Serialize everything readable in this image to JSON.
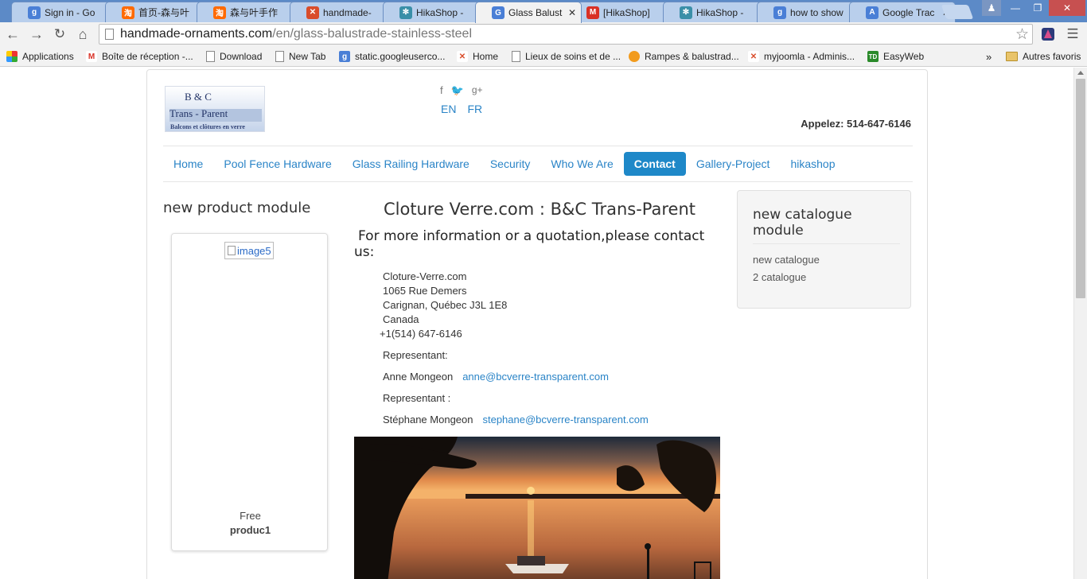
{
  "browser": {
    "tabs": [
      {
        "title": "Sign in - Go",
        "icon": "google-icon",
        "color": "#4a7fd6",
        "glyph": "g"
      },
      {
        "title": "首页-森与叶",
        "icon": "taobao-icon",
        "color": "#ff6a00",
        "glyph": "淘"
      },
      {
        "title": "森与叶手作",
        "icon": "taobao-icon",
        "color": "#ff6a00",
        "glyph": "淘"
      },
      {
        "title": "handmade-",
        "icon": "joomla-icon",
        "color": "#d94c2a",
        "glyph": "✕"
      },
      {
        "title": "HikaShop -",
        "icon": "hikashop-icon",
        "color": "#3a8fa8",
        "glyph": "✻"
      },
      {
        "title": "Glass Balust",
        "icon": "google-icon",
        "color": "#4a7fd6",
        "glyph": "G"
      },
      {
        "title": "[HikaShop]",
        "icon": "gmail-icon",
        "color": "#d93025",
        "glyph": "M"
      },
      {
        "title": "HikaShop -",
        "icon": "hikashop-icon",
        "color": "#3a8fa8",
        "glyph": "✻"
      },
      {
        "title": "how to show",
        "icon": "google-icon",
        "color": "#4a7fd6",
        "glyph": "g"
      },
      {
        "title": "Google Trac",
        "icon": "translate-icon",
        "color": "#4a7fd6",
        "glyph": "A"
      }
    ],
    "active_tab": 5,
    "url_host": "handmade-ornaments.com",
    "url_path": "/en/glass-balustrade-stainless-steel",
    "bookmarks": [
      {
        "label": "Applications",
        "icon": "apps-grid-icon"
      },
      {
        "label": "Boîte de réception -...",
        "icon": "gmail-icon"
      },
      {
        "label": "Download",
        "icon": "page-icon"
      },
      {
        "label": "New Tab",
        "icon": "page-icon"
      },
      {
        "label": "static.googleuserco...",
        "icon": "google-icon"
      },
      {
        "label": "Home",
        "icon": "joomla-icon"
      },
      {
        "label": "Lieux de soins et de ...",
        "icon": "page-icon"
      },
      {
        "label": "Rampes & balustrad...",
        "icon": "site-icon"
      },
      {
        "label": "myjoomla - Adminis...",
        "icon": "joomla-icon"
      },
      {
        "label": "EasyWeb",
        "icon": "td-bank-icon"
      }
    ],
    "bookmarks_overflow": "»",
    "other_bookmarks": "Autres favoris"
  },
  "site": {
    "logo": {
      "row1": "B    &    C",
      "row2": "Trans   -   Parent",
      "tagline": "Balcons et clôtures en verre"
    },
    "languages": [
      "EN",
      "FR"
    ],
    "phone": "Appelez: 514-647-6146",
    "menu": [
      "Home",
      "Pool Fence Hardware",
      "Glass Railing Hardware",
      "Security",
      "Who We Are",
      "Contact",
      "Gallery-Project",
      "hikashop"
    ],
    "active_menu": 5,
    "left_module": {
      "title": "new product module",
      "product": {
        "image_alt": "image5",
        "price": "Free",
        "name": "produc1"
      }
    },
    "main": {
      "title": "Cloture Verre.com : B&C Trans-Parent",
      "subtitle": "For more information or a quotation,please  contact us:",
      "address": [
        "Cloture-Verre.com",
        "1065 Rue Demers",
        "Carignan, Québec J3L 1E8",
        "Canada",
        "+1(514) 647-6146"
      ],
      "rep_label_1": "Representant:",
      "rep_name_1": "Anne Mongeon",
      "rep_email_1": "anne@bcverre-transparent.com",
      "rep_label_2": "Representant :",
      "rep_name_2": "Stéphane Mongeon",
      "rep_email_2": "stephane@bcverre-transparent.com"
    },
    "right_module": {
      "title": "new catalogue module",
      "items": [
        "new catalogue",
        "2 catalogue"
      ]
    }
  },
  "colors": {
    "link": "#2a84c7",
    "active_menu_bg": "#1e88c8",
    "tabstrip": "#5c8ac7"
  }
}
